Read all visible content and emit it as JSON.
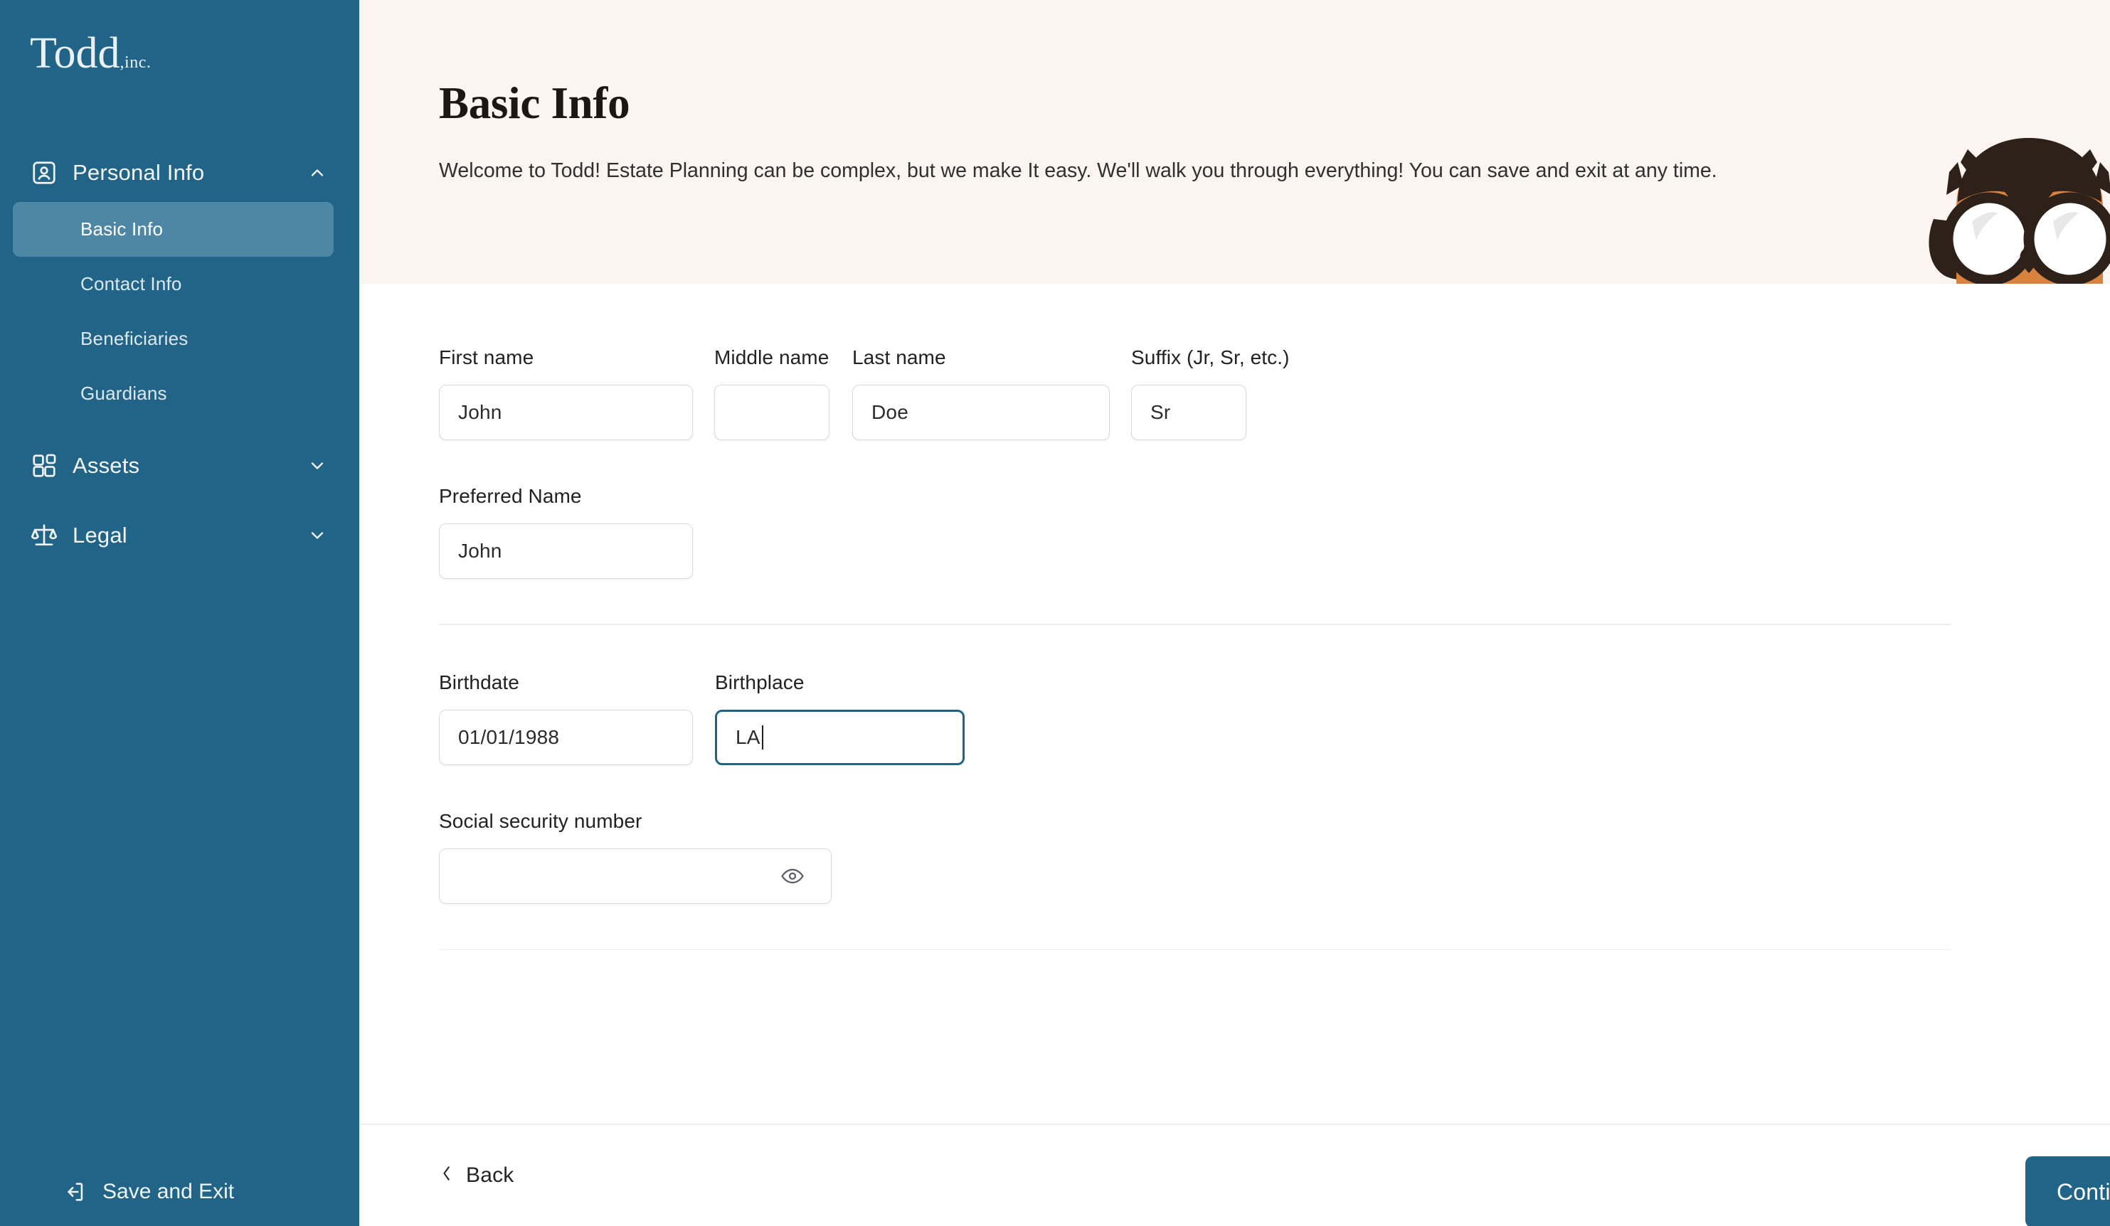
{
  "brand": {
    "name": "Todd",
    "suffix": ",inc."
  },
  "sidebar": {
    "groups": [
      {
        "label": "Personal Info",
        "icon": "user-card-icon",
        "chevron": "chevron-up-icon",
        "expanded": true,
        "items": [
          {
            "label": "Basic Info",
            "active": true
          },
          {
            "label": "Contact Info",
            "active": false
          },
          {
            "label": "Beneficiaries",
            "active": false
          },
          {
            "label": "Guardians",
            "active": false
          }
        ]
      },
      {
        "label": "Assets",
        "icon": "blocks-icon",
        "chevron": "chevron-down-icon",
        "expanded": false,
        "items": []
      },
      {
        "label": "Legal",
        "icon": "scales-icon",
        "chevron": "chevron-down-icon",
        "expanded": false,
        "items": []
      }
    ],
    "save_exit_label": "Save and Exit",
    "save_exit_icon": "exit-arrow-icon",
    "background_color": "#226488",
    "active_item_color": "#4d87a5"
  },
  "header": {
    "title": "Basic Info",
    "description": "Welcome to Todd! Estate Planning can be complex, but we make It easy. We'll walk you through everything! You can save and exit at any time.",
    "background_color": "#fbf4f0",
    "mascot": "owl-mascot-icon",
    "mascot_colors": {
      "body": "#d9813f",
      "dark": "#2e211a",
      "eye": "#ffffff"
    }
  },
  "form": {
    "rows": [
      {
        "fields": [
          {
            "label": "First name",
            "value": "John",
            "placeholder": "",
            "focused": false,
            "name": "first-name"
          },
          {
            "label": "Middle name",
            "value": "",
            "placeholder": "",
            "focused": false,
            "name": "middle-name"
          },
          {
            "label": "Last name",
            "value": "Doe",
            "placeholder": "",
            "focused": false,
            "name": "last-name"
          },
          {
            "label": "Suffix (Jr, Sr, etc.)",
            "value": "Sr",
            "placeholder": "",
            "focused": false,
            "name": "suffix"
          }
        ]
      },
      {
        "fields": [
          {
            "label": "Preferred Name",
            "value": "John",
            "placeholder": "",
            "focused": false,
            "name": "preferred-name"
          }
        ]
      },
      {
        "fields": [
          {
            "label": "Birthdate",
            "value": "01/01/1988",
            "placeholder": "",
            "focused": false,
            "name": "birthdate"
          },
          {
            "label": "Birthplace",
            "value": "LA",
            "placeholder": "",
            "focused": true,
            "name": "birthplace"
          }
        ]
      },
      {
        "fields": [
          {
            "label": "Social security number",
            "value": "",
            "placeholder": "",
            "focused": false,
            "name": "social-security-number",
            "reveal_icon": "eye-icon"
          }
        ]
      }
    ],
    "focus_border_color": "#226488"
  },
  "footer": {
    "back_label": "Back",
    "back_chevron": "chevron-left-icon",
    "continue_label": "Continue",
    "continue_color": "#226488"
  },
  "cursor": {
    "icon": "mouse-pointer-icon"
  }
}
